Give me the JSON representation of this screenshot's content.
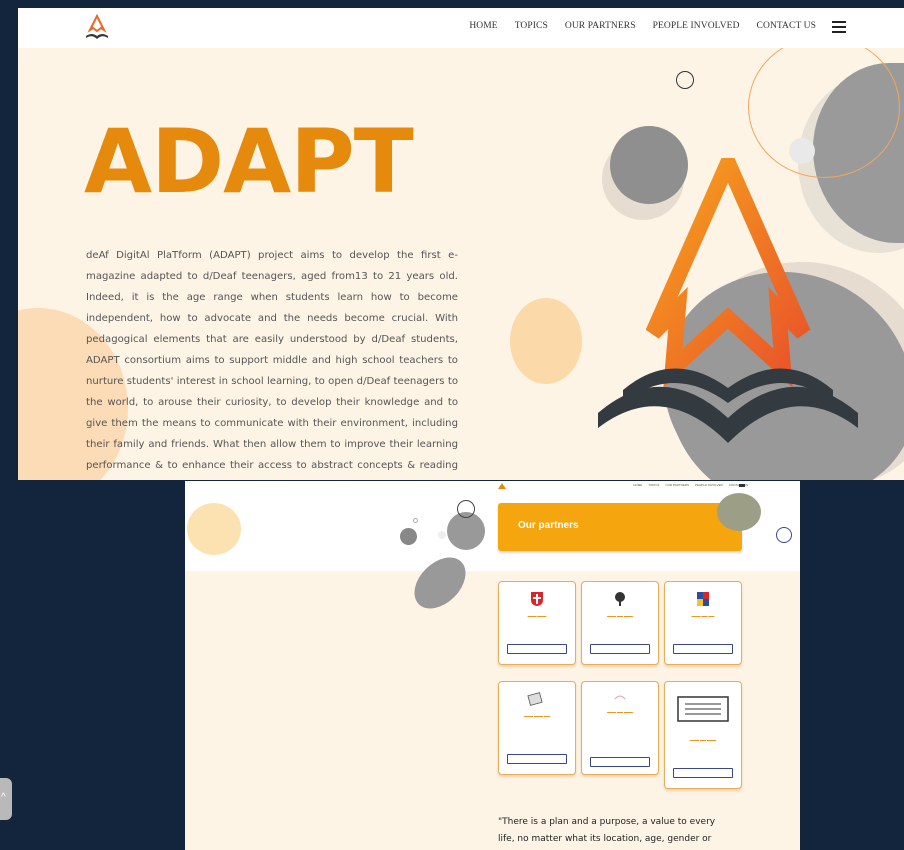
{
  "nav": {
    "links": [
      "HOME",
      "TOPICS",
      "OUR PARTNERS",
      "PEOPLE INVOLVED",
      "CONTACT US"
    ]
  },
  "hero": {
    "title": "ADAPT",
    "description": "deAf DigitAl PlaTform (ADAPT) project aims to develop the first e-magazine adapted to d/Deaf teenagers, aged from13 to 21 years old. Indeed, it is the age range when students learn how to become independent, how to advocate and the needs become crucial. With pedagogical elements that are easily understood by d/Deaf students, ADAPT consortium aims to support middle and high school teachers to nurture students' interest in school learning, to open d/Deaf teenagers to the world, to arouse their curiosity, to develop their knowledge and to give them the means to communicate with their environment, including their family and friends. What then allow them to improve their learning performance & to enhance their access to abstract concepts & reading potentialities."
  },
  "partners_page": {
    "banner_title": "Our partners",
    "quote": "\"There is a plan and a purpose, a value to every life, no matter what its location, age, gender or disability.\""
  },
  "colors": {
    "brand_orange": "#e58a0c",
    "banner_orange": "#f5a60f",
    "dark_navy": "#13243d",
    "cream": "#fdf4e6",
    "button_blue": "#3c4690"
  },
  "icons": [
    "adapt-logo-icon",
    "hamburger-menu-icon",
    "scroll-to-top-icon"
  ]
}
